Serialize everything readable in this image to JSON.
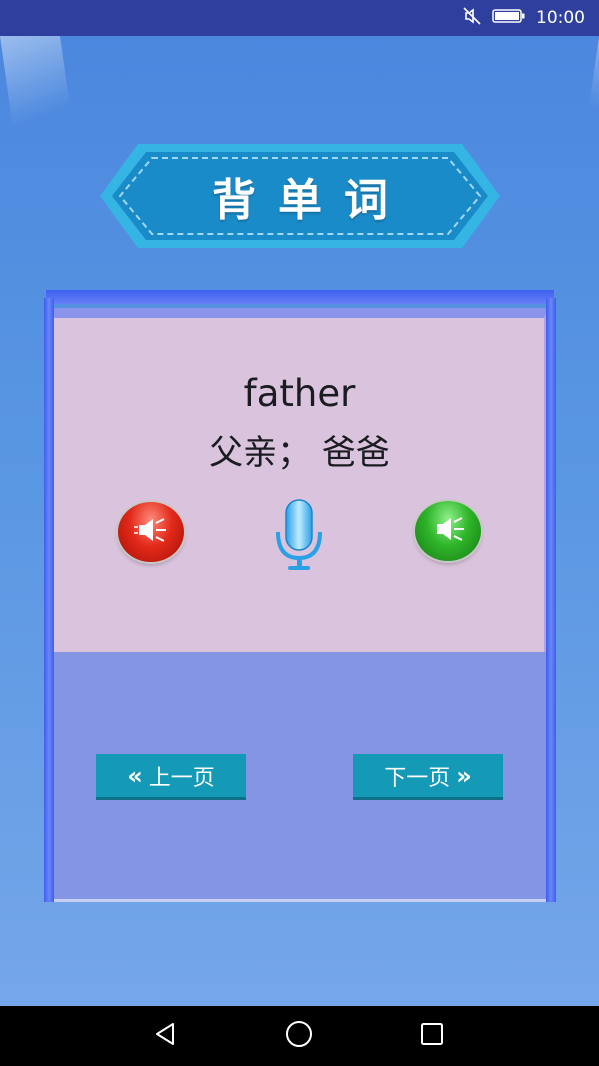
{
  "status_bar": {
    "time": "10:00",
    "icons": [
      "mute-icon",
      "battery-icon"
    ]
  },
  "title": {
    "text": "背单词",
    "colors": {
      "banner": "#1a8bc9",
      "banner_border": "#34b5e3"
    }
  },
  "word_card": {
    "english": "father",
    "chinese": "父亲； 爸爸",
    "buttons": [
      "play-red-button",
      "mic-button",
      "play-green-button"
    ]
  },
  "navigation": {
    "prev_label": "上一页",
    "next_label": "下一页",
    "prev_icon": "double-chevron-left-icon",
    "next_icon": "double-chevron-right-icon",
    "button_color": "#1499b6"
  },
  "system_nav": {
    "icons": [
      "back-icon",
      "home-icon",
      "recent-apps-icon"
    ]
  }
}
